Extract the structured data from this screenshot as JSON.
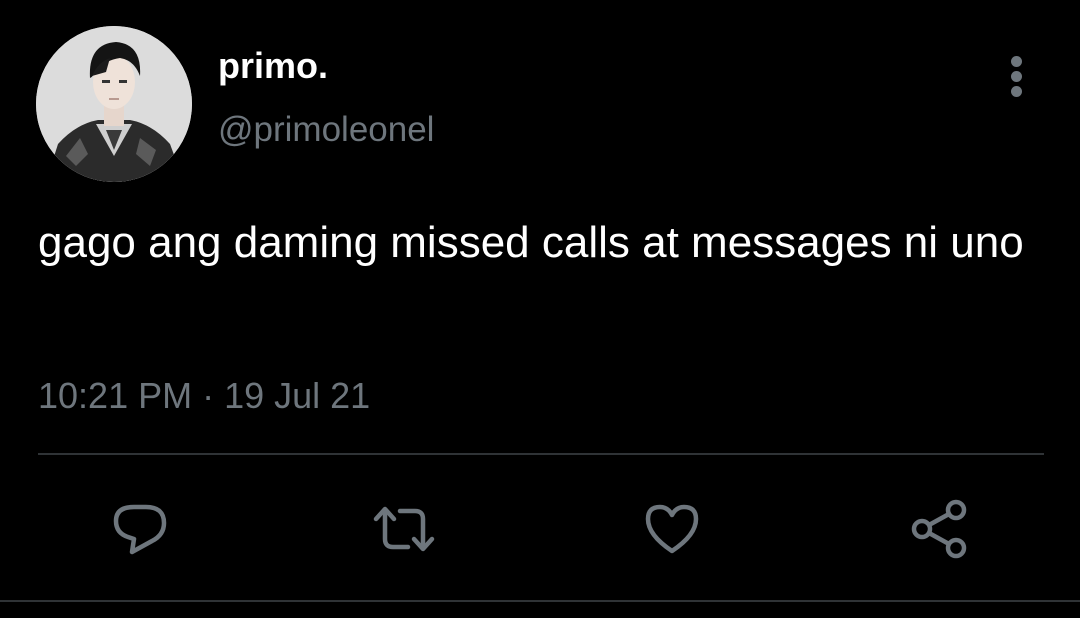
{
  "tweet": {
    "author": {
      "display_name": "primo.",
      "handle": "@primoleonel",
      "avatar_icon": "profile-photo"
    },
    "text": "gago ang daming missed calls at messages ni uno",
    "time": "10:21 PM",
    "separator": "·",
    "date": "19 Jul 21",
    "more_icon": "more-vertical-icon"
  },
  "actions": [
    {
      "name": "reply",
      "icon": "reply-icon"
    },
    {
      "name": "retweet",
      "icon": "retweet-icon"
    },
    {
      "name": "like",
      "icon": "heart-icon"
    },
    {
      "name": "share",
      "icon": "share-icon"
    }
  ],
  "colors": {
    "background": "#000000",
    "primary_text": "#ffffff",
    "secondary_text": "#6e767d",
    "icon": "#6e767d",
    "divider": "#2f3336"
  }
}
